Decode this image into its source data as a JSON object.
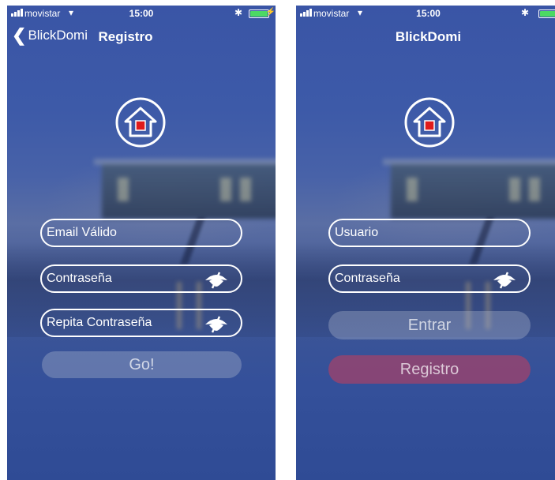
{
  "status": {
    "carrier": "movistar",
    "time": "15:00",
    "wifi_icon": "wifi-icon",
    "bluetooth_icon": "bluetooth-icon",
    "battery_level": 1.0
  },
  "left_screen": {
    "nav": {
      "back_label": "BlickDomi",
      "title": "Registro"
    },
    "fields": {
      "email_placeholder": "Email Válido",
      "password_placeholder": "Contraseña",
      "repeat_password_placeholder": "Repita Contraseña"
    },
    "go_button": "Go!"
  },
  "right_screen": {
    "nav": {
      "title": "BlickDomi"
    },
    "fields": {
      "user_placeholder": "Usuario",
      "password_placeholder": "Contraseña"
    },
    "enter_button": "Entrar",
    "register_button": "Registro"
  },
  "colors": {
    "accent_red": "#e01b1b",
    "register_button": "#c83c5a",
    "battery": "#4cd964"
  }
}
